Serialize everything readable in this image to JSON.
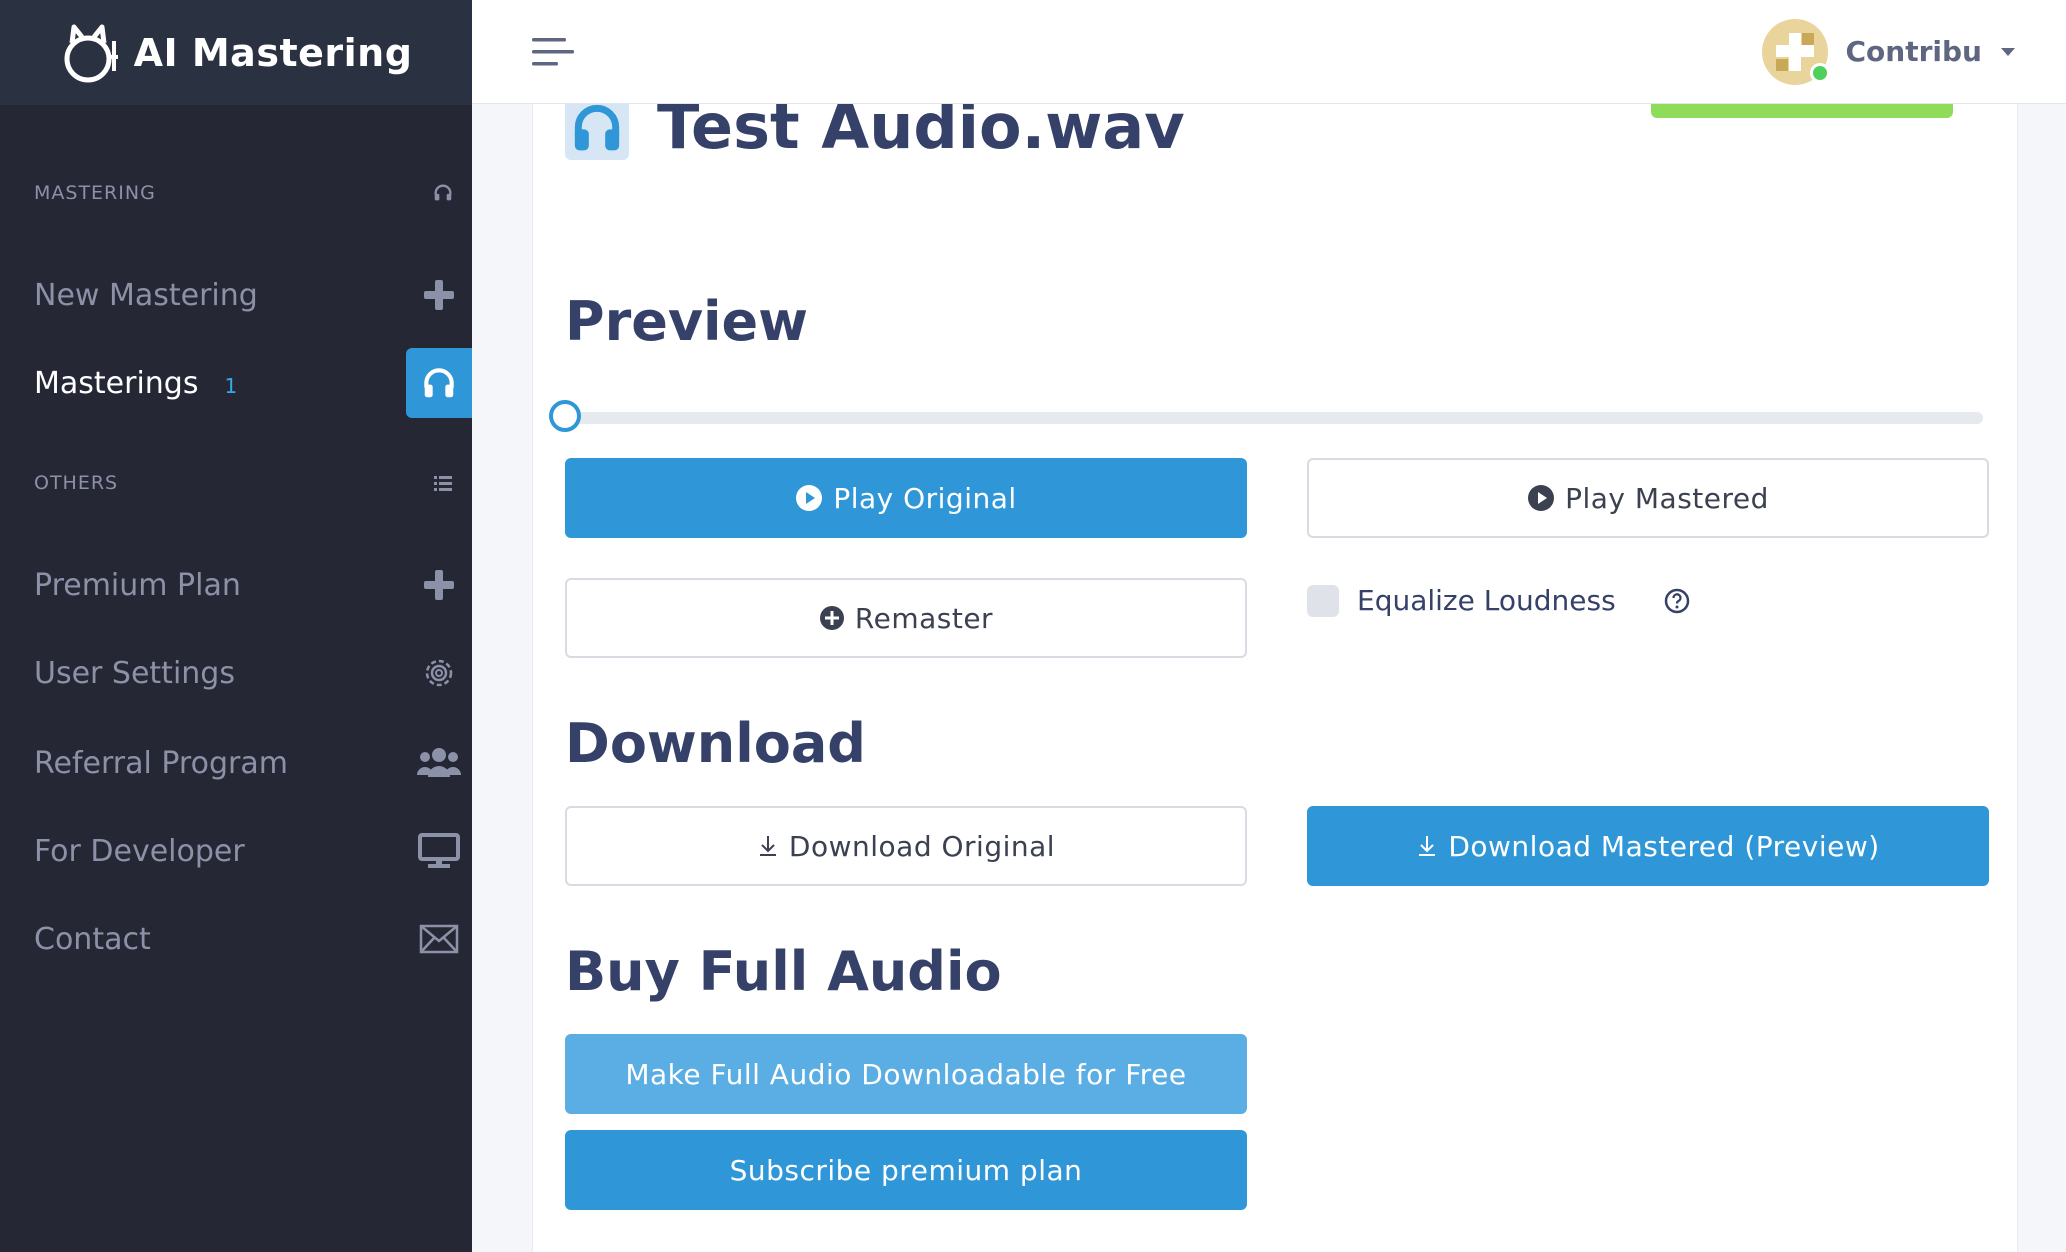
{
  "brand": {
    "name": "AI Mastering"
  },
  "sidebar": {
    "sections": [
      {
        "label": "MASTERING",
        "icon": "headphones-icon"
      },
      {
        "label": "OTHERS",
        "icon": "list-icon"
      }
    ],
    "items": [
      {
        "label": "New Mastering",
        "icon": "plus-icon"
      },
      {
        "label": "Masterings",
        "badge": "1",
        "icon": "headphones-icon",
        "active": true
      },
      {
        "label": "Premium Plan",
        "icon": "plus-icon"
      },
      {
        "label": "User Settings",
        "icon": "gear-icon"
      },
      {
        "label": "Referral Program",
        "icon": "users-icon"
      },
      {
        "label": "For Developer",
        "icon": "monitor-icon"
      },
      {
        "label": "Contact",
        "icon": "envelope-icon"
      }
    ]
  },
  "header": {
    "user_name": "Contribu"
  },
  "file": {
    "title": "Test Audio.wav"
  },
  "preview": {
    "heading": "Preview",
    "progress": 0,
    "play_original": "Play Original",
    "play_mastered": "Play Mastered",
    "remaster": "Remaster",
    "equalize_loudness": "Equalize Loudness",
    "equalize_checked": false
  },
  "download": {
    "heading": "Download",
    "original": "Download Original",
    "mastered": "Download Mastered (Preview)"
  },
  "buy": {
    "heading": "Buy Full Audio",
    "free": "Make Full Audio Downloadable for Free",
    "subscribe": "Subscribe premium plan"
  },
  "colors": {
    "primary": "#2f97d8",
    "sidebar": "#262735",
    "heading": "#354168",
    "status_green": "#8fdc5a"
  }
}
